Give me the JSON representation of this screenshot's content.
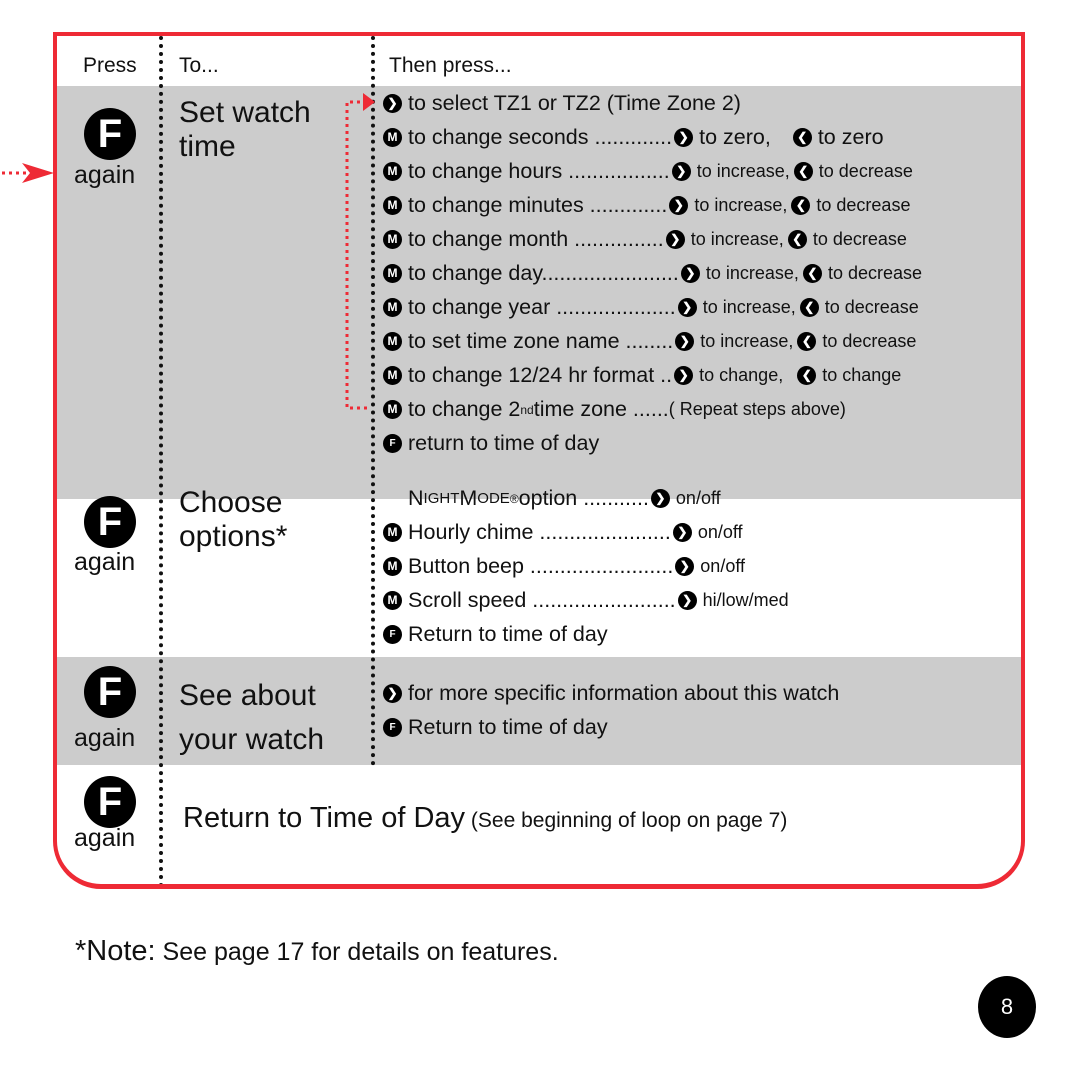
{
  "header": {
    "press": "Press",
    "to": "To...",
    "then": "Then press..."
  },
  "icons": {
    "f": "F",
    "m": "M",
    "right": "❯",
    "left": "❮"
  },
  "sections": [
    {
      "again": "again",
      "to_line1": "Set watch",
      "to_line2": "time",
      "lines": [
        {
          "icon": "right",
          "text": "to select TZ1 or TZ2 (Time Zone  2)"
        },
        {
          "icon": "m",
          "text": "to change seconds .............",
          "r": "to zero,",
          "l": "to zero"
        },
        {
          "icon": "m",
          "text": "to change hours .................",
          "r": "to increase,",
          "l": "to decrease"
        },
        {
          "icon": "m",
          "text": "to change minutes .............",
          "r": "to increase,",
          "l": "to decrease"
        },
        {
          "icon": "m",
          "text": "to change month  ...............",
          "r": "to increase,",
          "l": "to decrease"
        },
        {
          "icon": "m",
          "text": "to change day.......................",
          "r": "to increase,",
          "l": "to decrease"
        },
        {
          "icon": "m",
          "text": "to change year ....................",
          "r": "to increase,",
          "l": "to decrease"
        },
        {
          "icon": "m",
          "text": "to set time zone name ........",
          "r": "to increase,",
          "l": "to decrease"
        },
        {
          "icon": "m",
          "text": "to change 12/24 hr format ..",
          "r": "to change,",
          "l": "to change"
        },
        {
          "icon": "m",
          "text_a": "to change 2",
          "sup": "nd",
          "text_b": " time zone ......",
          "tail": "( Repeat steps above)"
        },
        {
          "icon": "f",
          "text": "return to time of day"
        }
      ]
    },
    {
      "again": "again",
      "to_line1": "Choose",
      "to_line2": "options*",
      "lines": [
        {
          "icon": "none",
          "nm_a": "N",
          "nm_b": "IGHT",
          "nm_c": " M",
          "nm_d": "ODE",
          "reg": "®",
          "text": " option ...........",
          "r": "on/off"
        },
        {
          "icon": "m",
          "text": "Hourly chime ......................",
          "r": "on/off"
        },
        {
          "icon": "m",
          "text": "Button beep ........................",
          "r": "on/off"
        },
        {
          "icon": "m",
          "text": "Scroll speed ........................",
          "r": "hi/low/med"
        },
        {
          "icon": "f",
          "text": "Return to time of day"
        }
      ]
    },
    {
      "again": "again",
      "to_line1": "See about",
      "to_line2": "your watch",
      "lines": [
        {
          "icon": "right",
          "text": "for more specific information about this watch"
        },
        {
          "icon": "f",
          "text": "Return to time of day"
        }
      ]
    },
    {
      "again": "again",
      "main": "Return to Time of Day",
      "sub": " (See beginning of loop on page 7)"
    }
  ],
  "note": {
    "prefix": "*Note:",
    "text": " See page 17 for details on features."
  },
  "page_number": "8",
  "colors": {
    "accent_red": "#ee2a35",
    "band_gray": "#cccccc"
  }
}
